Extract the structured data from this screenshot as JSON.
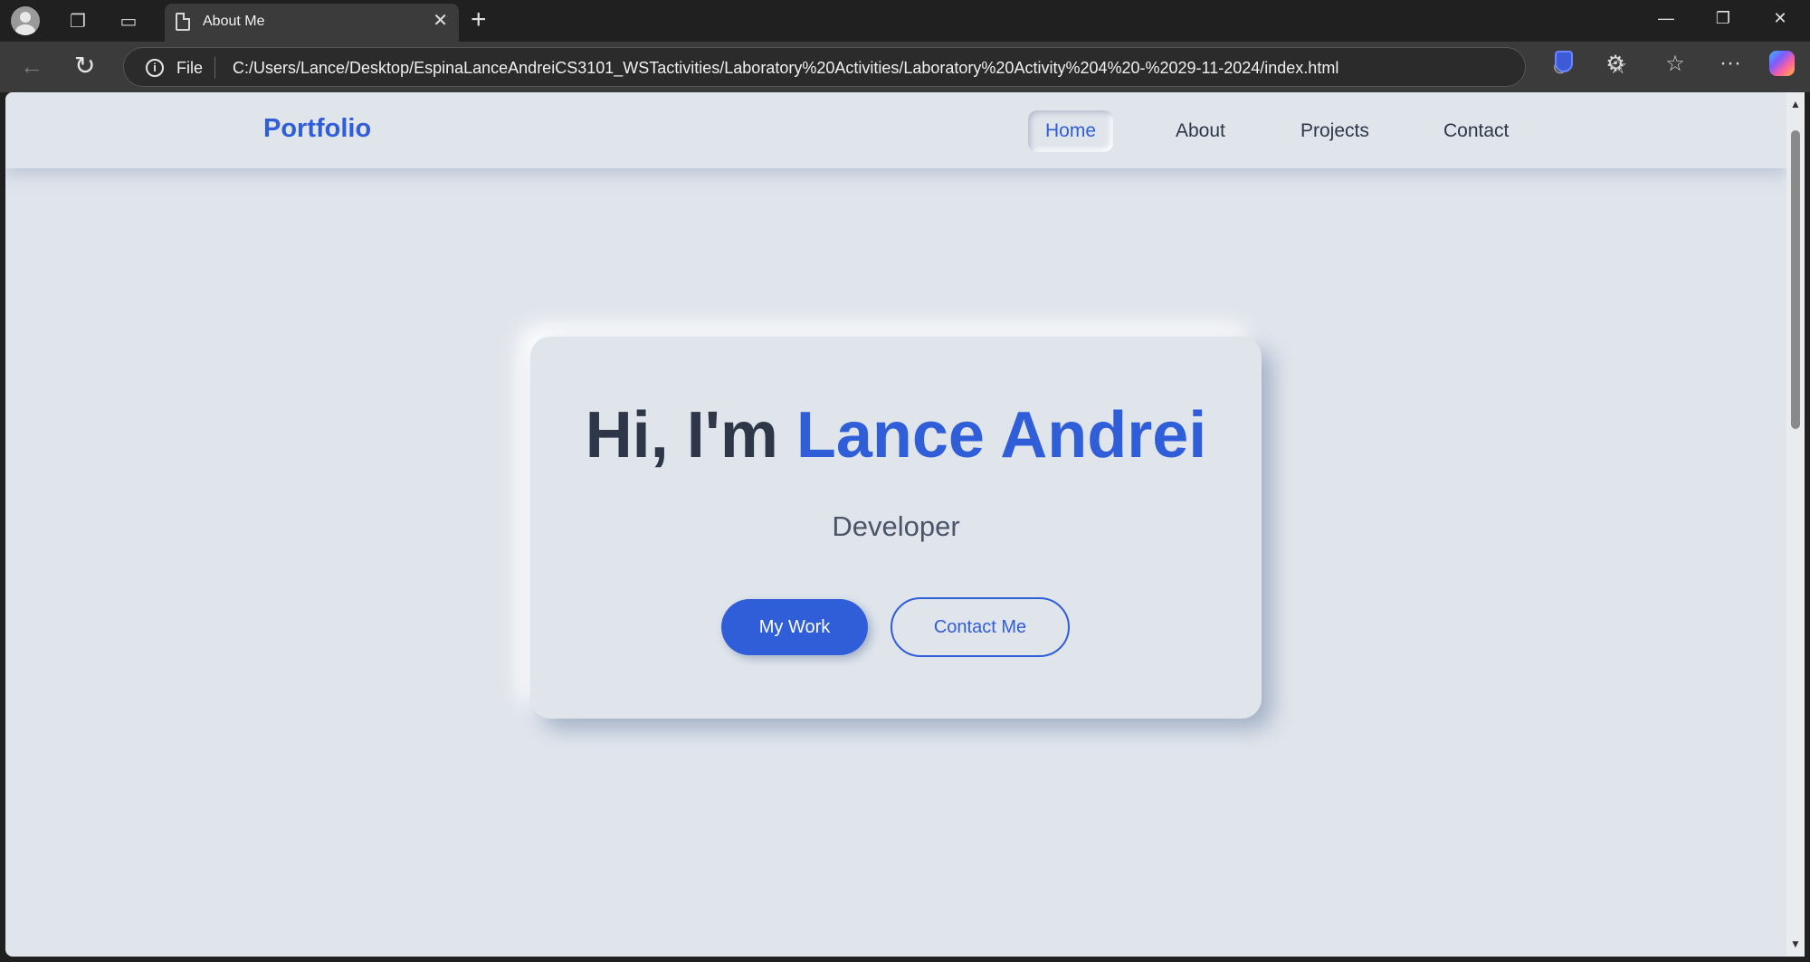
{
  "browser": {
    "tab_title": "About Me",
    "address_scheme": "File",
    "url": "C:/Users/Lance/Desktop/EspinaLanceAndreiCS3101_WSTactivities/Laboratory%20Activities/Laboratory%20Activity%204%20-%2029-11-2024/index.html",
    "icons": {
      "profile": "profile-avatar-icon",
      "workspaces": "workspaces-icon",
      "tab_actions": "tab-actions-icon",
      "page": "page-icon",
      "close": "close-icon",
      "new_tab": "plus-icon",
      "back": "back-arrow-icon",
      "refresh": "refresh-icon",
      "info": "info-icon",
      "zoom": "zoom-out-icon",
      "favorite": "star-icon",
      "shield": "shield-icon",
      "extensions": "puzzle-icon",
      "favorites": "favorites-icon",
      "more": "more-icon",
      "copilot": "copilot-icon"
    }
  },
  "page": {
    "brand": "Portfolio",
    "nav": {
      "home": "Home",
      "about": "About",
      "projects": "Projects",
      "contact": "Contact",
      "active": "Home"
    },
    "hero": {
      "greeting": "Hi, I'm",
      "name": "Lance Andrei",
      "role": "Developer",
      "primary_button": "My Work",
      "secondary_button": "Contact Me"
    },
    "colors": {
      "accent": "#2f5ed8",
      "background": "#e0e5ec",
      "text": "#2d3748"
    }
  }
}
